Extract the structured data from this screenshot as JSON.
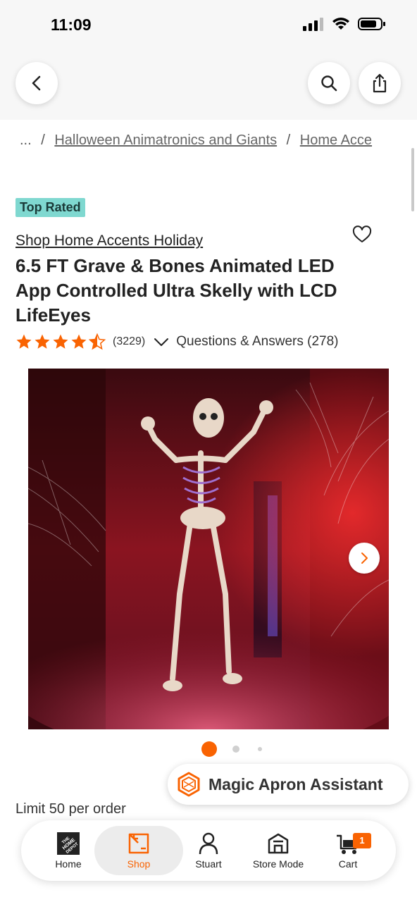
{
  "status_bar": {
    "time": "11:09"
  },
  "breadcrumb": {
    "ellipsis": "...",
    "items": [
      "Halloween Animatronics and Giants",
      "Home Acce"
    ]
  },
  "product": {
    "badge": "Top Rated",
    "brand_link": "Shop Home Accents Holiday",
    "title": "6.5 FT Grave & Bones Animated LED App Controlled Ultra Skelly with LCD LifeEyes",
    "rating": 4.5,
    "review_count": "(3229)",
    "qa_link": "Questions & Answers (278)",
    "limit": "Limit 50 per order"
  },
  "gallery": {
    "total_dots": 3,
    "active_index": 0
  },
  "assistant": {
    "label": "Magic Apron Assistant"
  },
  "nav": {
    "items": [
      {
        "label": "Home",
        "icon": "home-depot-logo-icon"
      },
      {
        "label": "Shop",
        "icon": "shop-icon",
        "active": true
      },
      {
        "label": "Stuart",
        "icon": "person-icon"
      },
      {
        "label": "Store Mode",
        "icon": "store-icon"
      },
      {
        "label": "Cart",
        "icon": "cart-icon"
      }
    ],
    "cart_count": "1"
  },
  "colors": {
    "accent": "#f96302",
    "badge_bg": "#7fd8d0",
    "star": "#f96302"
  }
}
